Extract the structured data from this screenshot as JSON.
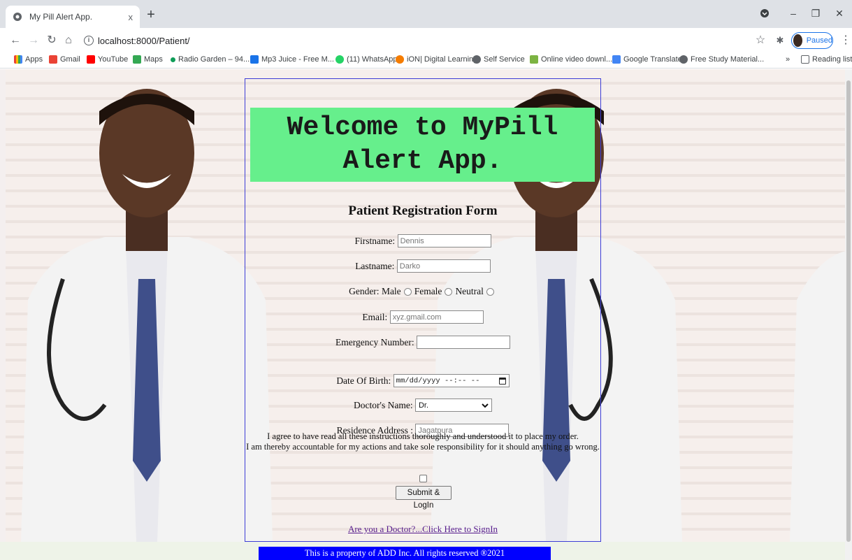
{
  "browser": {
    "tab_title": "My Pill Alert App.",
    "tab_close": "x",
    "new_tab": "+",
    "url": "localhost:8000/Patient/",
    "profile_label": "Paused",
    "bookmarks": [
      {
        "label": "Apps",
        "icon": "apps-grid-icon",
        "color": "#4285f4"
      },
      {
        "label": "Gmail",
        "icon": "gmail-icon",
        "color": "#ea4335"
      },
      {
        "label": "YouTube",
        "icon": "youtube-icon",
        "color": "#ff0000"
      },
      {
        "label": "Maps",
        "icon": "maps-icon",
        "color": "#34a853"
      },
      {
        "label": "Radio Garden – 94....",
        "icon": "globe-dot-icon",
        "color": "#0f9d58"
      },
      {
        "label": "Mp3 Juice - Free M...",
        "icon": "download-icon",
        "color": "#1a73e8"
      },
      {
        "label": "(11) WhatsApp",
        "icon": "whatsapp-icon",
        "color": "#25d366"
      },
      {
        "label": "iON| Digital Learning",
        "icon": "power-icon",
        "color": "#f57c00"
      },
      {
        "label": "Self Service",
        "icon": "globe-icon",
        "color": "#5f6368"
      },
      {
        "label": "Online video downl...",
        "icon": "leaf-icon",
        "color": "#7cb342"
      },
      {
        "label": "Google Translate",
        "icon": "translate-icon",
        "color": "#4285f4"
      },
      {
        "label": "Free Study Material...",
        "icon": "globe-icon",
        "color": "#5f6368"
      }
    ],
    "bookmarks_overflow": "»",
    "reading_list": "Reading list"
  },
  "page": {
    "banner_title": "Welcome to MyPill Alert App.",
    "form_title": "Patient Registration Form",
    "firstname_label": "Firstname:",
    "firstname_placeholder": "Dennis",
    "lastname_label": "Lastname:",
    "lastname_placeholder": "Darko",
    "gender_label": "Gender:",
    "gender_options": [
      "Male",
      "Female",
      "Neutral"
    ],
    "email_label": "Email:",
    "email_placeholder": "xyz.gmail.com",
    "emergency_label": "Emergency Number:",
    "dob_label": "Date Of Birth:",
    "dob_value": "mm/dd/yyyy --:-- --",
    "doctor_label": "Doctor's Name:",
    "doctor_value": "Dr.",
    "address_label": "Residence Address :",
    "address_placeholder": "Jagatpura",
    "agree_line1": "I agree to have read all these instructions thoroughly and understood it to place my order.",
    "agree_line2": "I am thereby accountable for my actions and take sole responsibility for it should anything go wrong.",
    "submit_label": "Submit & LogIn",
    "signin_link": "Are you a Doctor?...Click Here to SignIn",
    "footer_text": "This is a property of ADD Inc. All rights reserved ®2021"
  },
  "colors": {
    "banner_bg": "#66ef8c",
    "frame_border": "#3d3dd6",
    "footer_bg": "#0000ff",
    "link": "#551a8b"
  }
}
